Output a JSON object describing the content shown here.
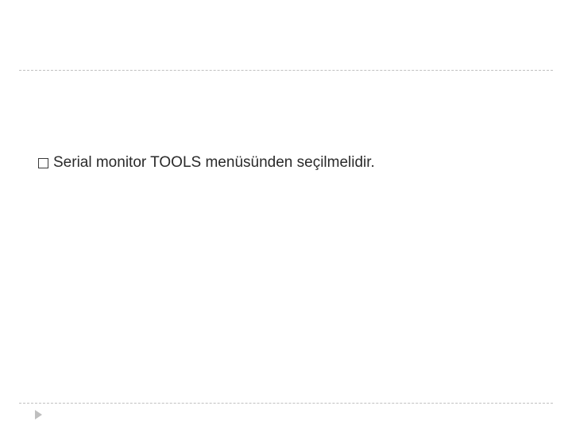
{
  "slide": {
    "bullet_text": "Serial monitor TOOLS menüsünden seçilmelidir."
  }
}
